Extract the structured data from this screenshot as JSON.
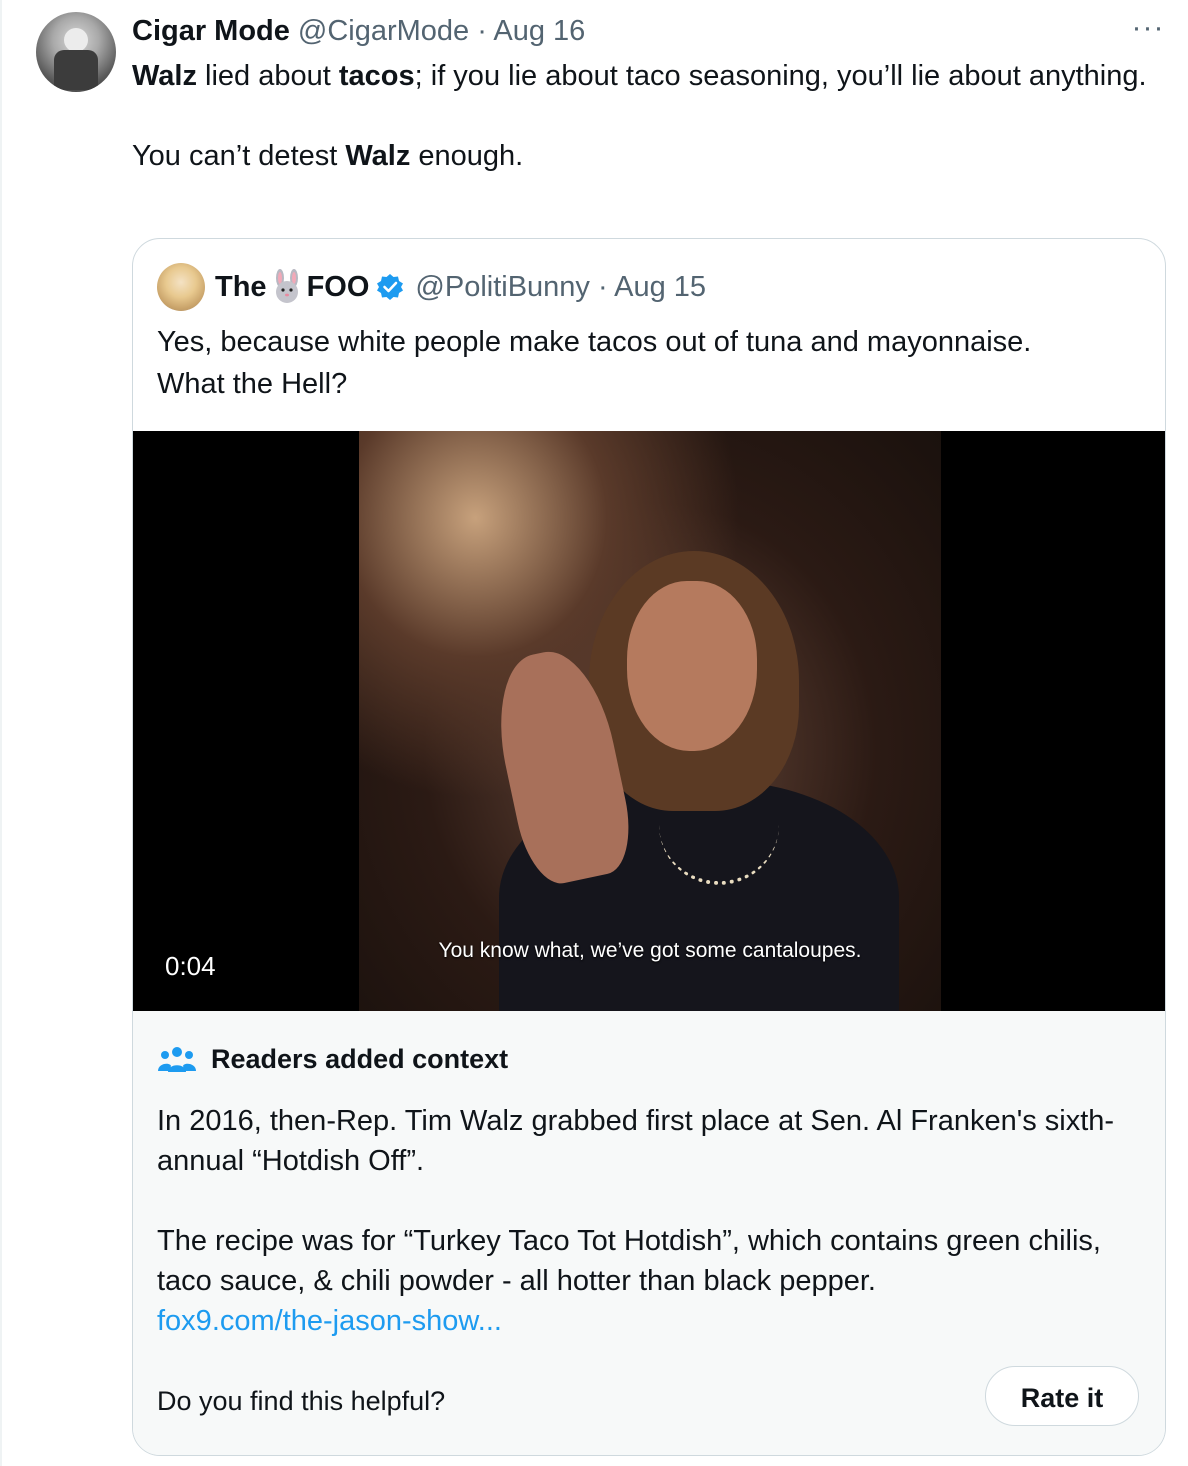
{
  "tweet": {
    "author_name": "Cigar Mode",
    "author_meta": "@CigarMode · Aug 16",
    "more_label": "···",
    "line1_b1": "Walz",
    "line1_t1": " lied about ",
    "line1_b2": "tacos",
    "line1_t2": "; if you lie about taco seasoning, you’ll lie about anything.",
    "line2_t1": "You can’t detest ",
    "line2_b1": "Walz",
    "line2_t2": " enough."
  },
  "quote": {
    "name_a": "The",
    "name_b": "FOO",
    "meta": "@PolitiBunny · Aug 15",
    "line1": "Yes, because white people make tacos out of tuna and mayonnaise.",
    "line2": "What the Hell?",
    "video": {
      "caption": "You know what, we’ve got some cantaloupes.",
      "duration": "0:04"
    }
  },
  "context": {
    "title": "Readers added context",
    "para1": "In 2016, then-Rep. Tim Walz grabbed first place at Sen. Al Franken's sixth-annual “Hotdish Off”.",
    "para2": "The recipe was for “Turkey Taco Tot Hotdish”, which contains green chilis, taco sauce, & chili powder - all hotter than black pepper.",
    "link": "fox9.com/the-jason-show...",
    "question": "Do you find this helpful?",
    "rate_label": "Rate it"
  },
  "colors": {
    "text": "#0f1419",
    "secondary": "#536471",
    "link": "#1d9bf0",
    "border": "#cfd9de",
    "context_bg": "#f7f9f9"
  },
  "icons": [
    "more-icon",
    "bunny-icon",
    "verified-badge-icon",
    "readers-context-icon"
  ]
}
